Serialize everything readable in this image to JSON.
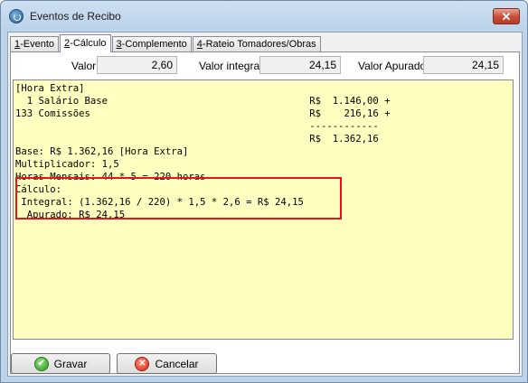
{
  "window": {
    "title": "Eventos de Recibo",
    "close_glyph": "✕"
  },
  "tabs": [
    {
      "key": "1",
      "label": "-Evento"
    },
    {
      "key": "2",
      "label": "-Cálculo"
    },
    {
      "key": "3",
      "label": "-Complemento"
    },
    {
      "key": "4",
      "label": "-Rateio Tomadores/Obras"
    }
  ],
  "fields": {
    "valor_label": "Valor",
    "valor": "2,60",
    "valor_integral_label": "Valor integral",
    "valor_integral": "24,15",
    "valor_apurado_label": "Valor Apurado",
    "valor_apurado": "24,15"
  },
  "memo": {
    "text": "[Hora Extra]\n  1 Salário Base                                   R$  1.146,00 +\n133 Comissões                                      R$    216,16 +\n                                                   ------------\n                                                   R$  1.362,16\nBase: R$ 1.362,16 [Hora Extra]\nMultiplicador: 1,5\nHoras Mensais: 44 * 5 = 220 horas\nCálculo:\n Integral: (1.362,16 / 220) * 1,5 * 2,6 = R$ 24,15\n  Apurado: R$ 24,15"
  },
  "buttons": {
    "save_label": "Gravar",
    "cancel_label": "Cancelar",
    "save_icon_glyph": "✔",
    "cancel_icon_glyph": "✕"
  }
}
